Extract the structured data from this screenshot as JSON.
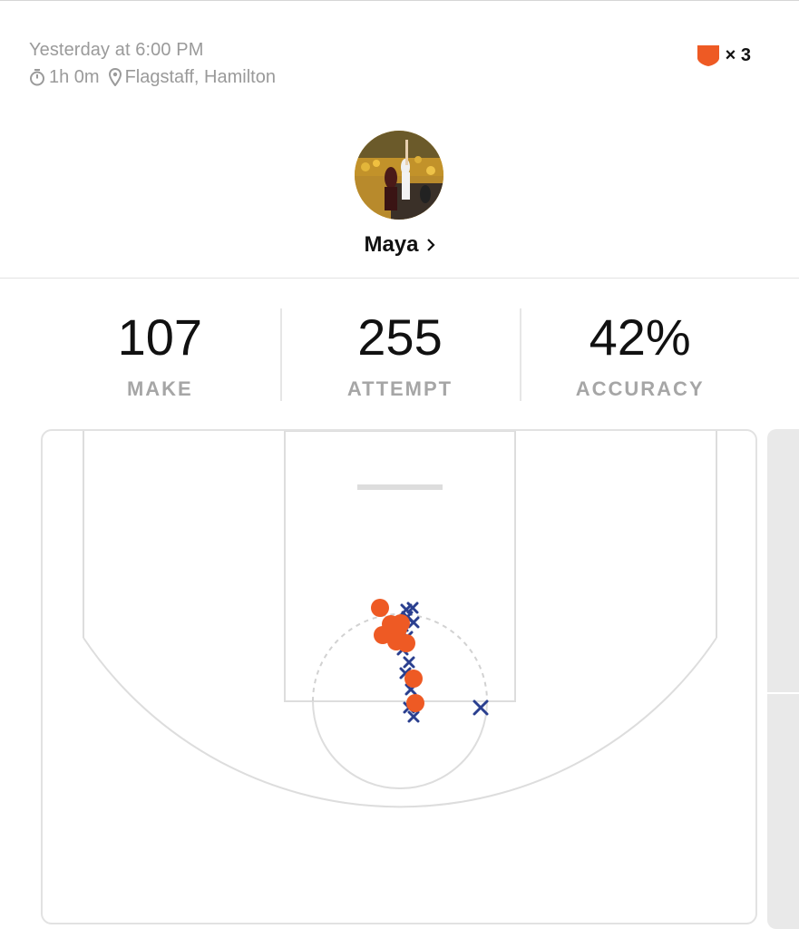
{
  "session": {
    "time": "Yesterday at 6:00 PM",
    "duration": "1h 0m",
    "location": "Flagstaff, Hamilton",
    "badge_count": "× 3"
  },
  "player": {
    "name": "Maya"
  },
  "stats": {
    "make": {
      "value": "107",
      "label": "MAKE"
    },
    "attempt": {
      "value": "255",
      "label": "ATTEMPT"
    },
    "accuracy": {
      "value": "42%",
      "label": "ACCURACY"
    }
  },
  "colors": {
    "make": "#EE5A24",
    "miss": "#2A3F8F",
    "badge": "#EE5A24",
    "court_line": "#dddddd"
  },
  "icons": {
    "duration": "stopwatch-icon",
    "location": "location-pin-icon",
    "badge": "shield-badge-icon",
    "chevron": "chevron-right-icon"
  }
}
